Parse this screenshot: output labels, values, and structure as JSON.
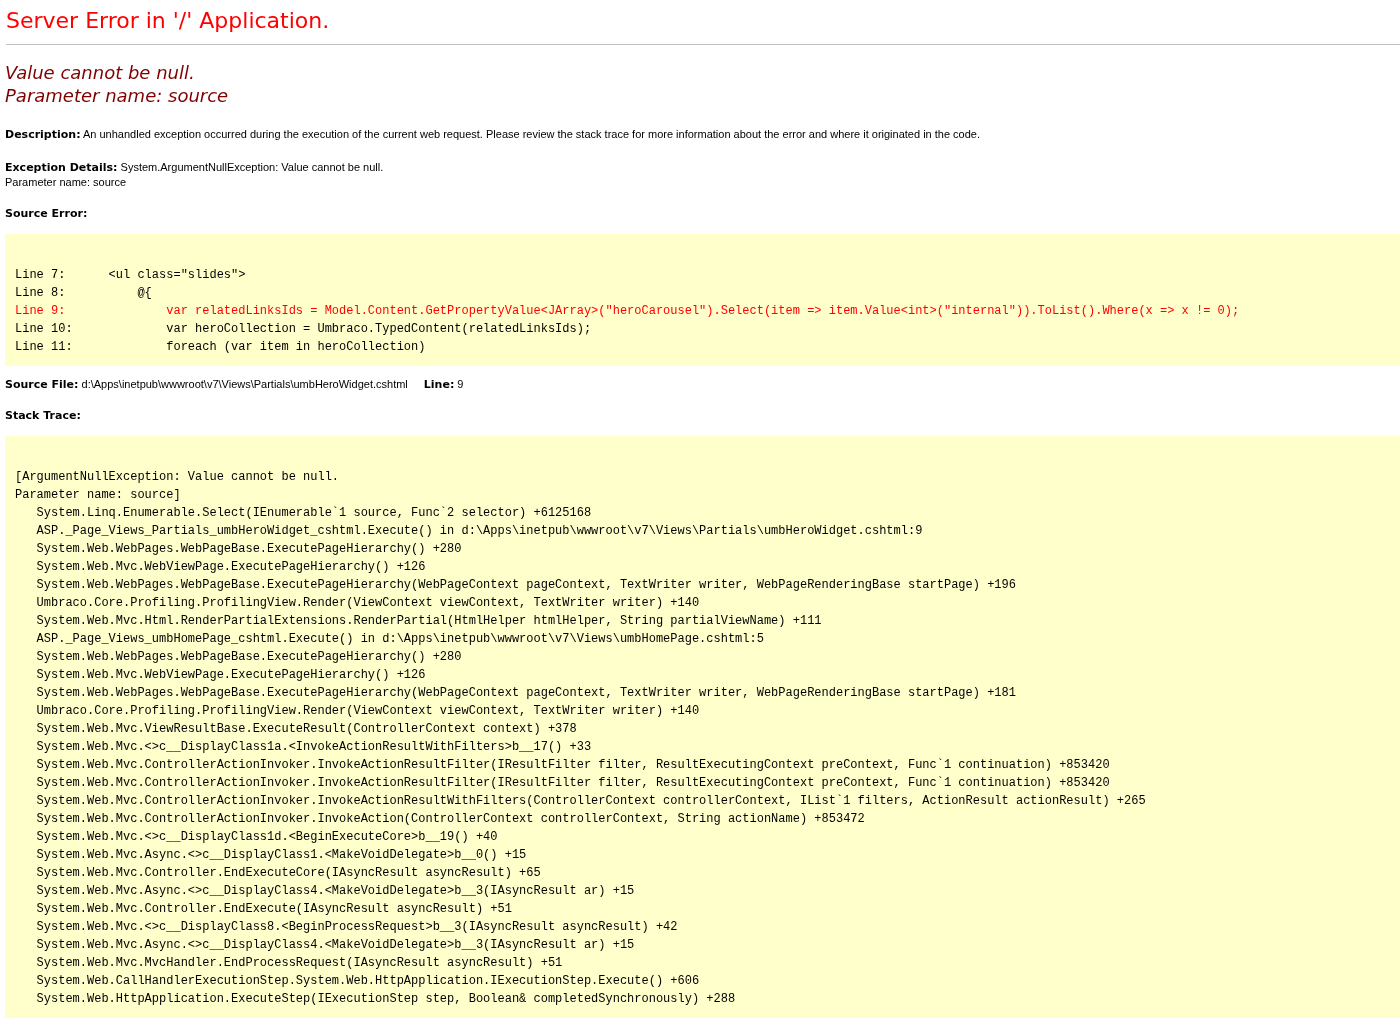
{
  "title": "Server Error in '/' Application.",
  "error_message": [
    "Value cannot be null.",
    "Parameter name: source"
  ],
  "description": "**Description:** An unhandled exception occurred during the execution of the current web request. Please review the stack trace for more information about the error and where it originated in the code.",
  "exception_details": [
    "**Exception Details:** System.ArgumentNullException: Value cannot be null.",
    "Parameter name: source"
  ],
  "source_error": {
    "heading": "Source Error:",
    "lines": [
      {
        "text": "Line 7:      <ul class=\"slides\">",
        "highlighted": false
      },
      {
        "text": "Line 8:          @{",
        "highlighted": false
      },
      {
        "text": "Line 9:              var relatedLinksIds = Model.Content.GetPropertyValue<JArray>(\"heroCarousel\").Select(item => item.Value<int>(\"internal\")).ToList().Where(x => x != 0);",
        "highlighted": true
      },
      {
        "text": "Line 10:             var heroCollection = Umbraco.TypedContent(relatedLinksIds);",
        "highlighted": false
      },
      {
        "text": "Line 11:             foreach (var item in heroCollection)",
        "highlighted": false
      }
    ]
  },
  "source_file": {
    "label": "Source File:",
    "path": "d:\\Apps\\inetpub\\wwwroot\\v7\\Views\\Partials\\umbHeroWidget.cshtml",
    "line_label": "Line:",
    "line": "9"
  },
  "stack_trace": {
    "heading": "Stack Trace:",
    "lines": [
      "[ArgumentNullException: Value cannot be null.",
      "Parameter name: source]",
      "   System.Linq.Enumerable.Select(IEnumerable`1 source, Func`2 selector) +6125168",
      "   ASP._Page_Views_Partials_umbHeroWidget_cshtml.Execute() in d:\\Apps\\inetpub\\wwwroot\\v7\\Views\\Partials\\umbHeroWidget.cshtml:9",
      "   System.Web.WebPages.WebPageBase.ExecutePageHierarchy() +280",
      "   System.Web.Mvc.WebViewPage.ExecutePageHierarchy() +126",
      "   System.Web.WebPages.WebPageBase.ExecutePageHierarchy(WebPageContext pageContext, TextWriter writer, WebPageRenderingBase startPage) +196",
      "   Umbraco.Core.Profiling.ProfilingView.Render(ViewContext viewContext, TextWriter writer) +140",
      "   System.Web.Mvc.Html.RenderPartialExtensions.RenderPartial(HtmlHelper htmlHelper, String partialViewName) +111",
      "   ASP._Page_Views_umbHomePage_cshtml.Execute() in d:\\Apps\\inetpub\\wwwroot\\v7\\Views\\umbHomePage.cshtml:5",
      "   System.Web.WebPages.WebPageBase.ExecutePageHierarchy() +280",
      "   System.Web.Mvc.WebViewPage.ExecutePageHierarchy() +126",
      "   System.Web.WebPages.WebPageBase.ExecutePageHierarchy(WebPageContext pageContext, TextWriter writer, WebPageRenderingBase startPage) +181",
      "   Umbraco.Core.Profiling.ProfilingView.Render(ViewContext viewContext, TextWriter writer) +140",
      "   System.Web.Mvc.ViewResultBase.ExecuteResult(ControllerContext context) +378",
      "   System.Web.Mvc.<>c__DisplayClass1a.<InvokeActionResultWithFilters>b__17() +33",
      "   System.Web.Mvc.ControllerActionInvoker.InvokeActionResultFilter(IResultFilter filter, ResultExecutingContext preContext, Func`1 continuation) +853420",
      "   System.Web.Mvc.ControllerActionInvoker.InvokeActionResultFilter(IResultFilter filter, ResultExecutingContext preContext, Func`1 continuation) +853420",
      "   System.Web.Mvc.ControllerActionInvoker.InvokeActionResultWithFilters(ControllerContext controllerContext, IList`1 filters, ActionResult actionResult) +265",
      "   System.Web.Mvc.ControllerActionInvoker.InvokeAction(ControllerContext controllerContext, String actionName) +853472",
      "   System.Web.Mvc.<>c__DisplayClass1d.<BeginExecuteCore>b__19() +40",
      "   System.Web.Mvc.Async.<>c__DisplayClass1.<MakeVoidDelegate>b__0() +15",
      "   System.Web.Mvc.Controller.EndExecuteCore(IAsyncResult asyncResult) +65",
      "   System.Web.Mvc.Async.<>c__DisplayClass4.<MakeVoidDelegate>b__3(IAsyncResult ar) +15",
      "   System.Web.Mvc.Controller.EndExecute(IAsyncResult asyncResult) +51",
      "   System.Web.Mvc.<>c__DisplayClass8.<BeginProcessRequest>b__3(IAsyncResult asyncResult) +42",
      "   System.Web.Mvc.Async.<>c__DisplayClass4.<MakeVoidDelegate>b__3(IAsyncResult ar) +15",
      "   System.Web.Mvc.MvcHandler.EndProcessRequest(IAsyncResult asyncResult) +51",
      "   System.Web.CallHandlerExecutionStep.System.Web.HttpApplication.IExecutionStep.Execute() +606",
      "   System.Web.HttpApplication.ExecuteStep(IExecutionStep step, Boolean& completedSynchronously) +288"
    ]
  }
}
